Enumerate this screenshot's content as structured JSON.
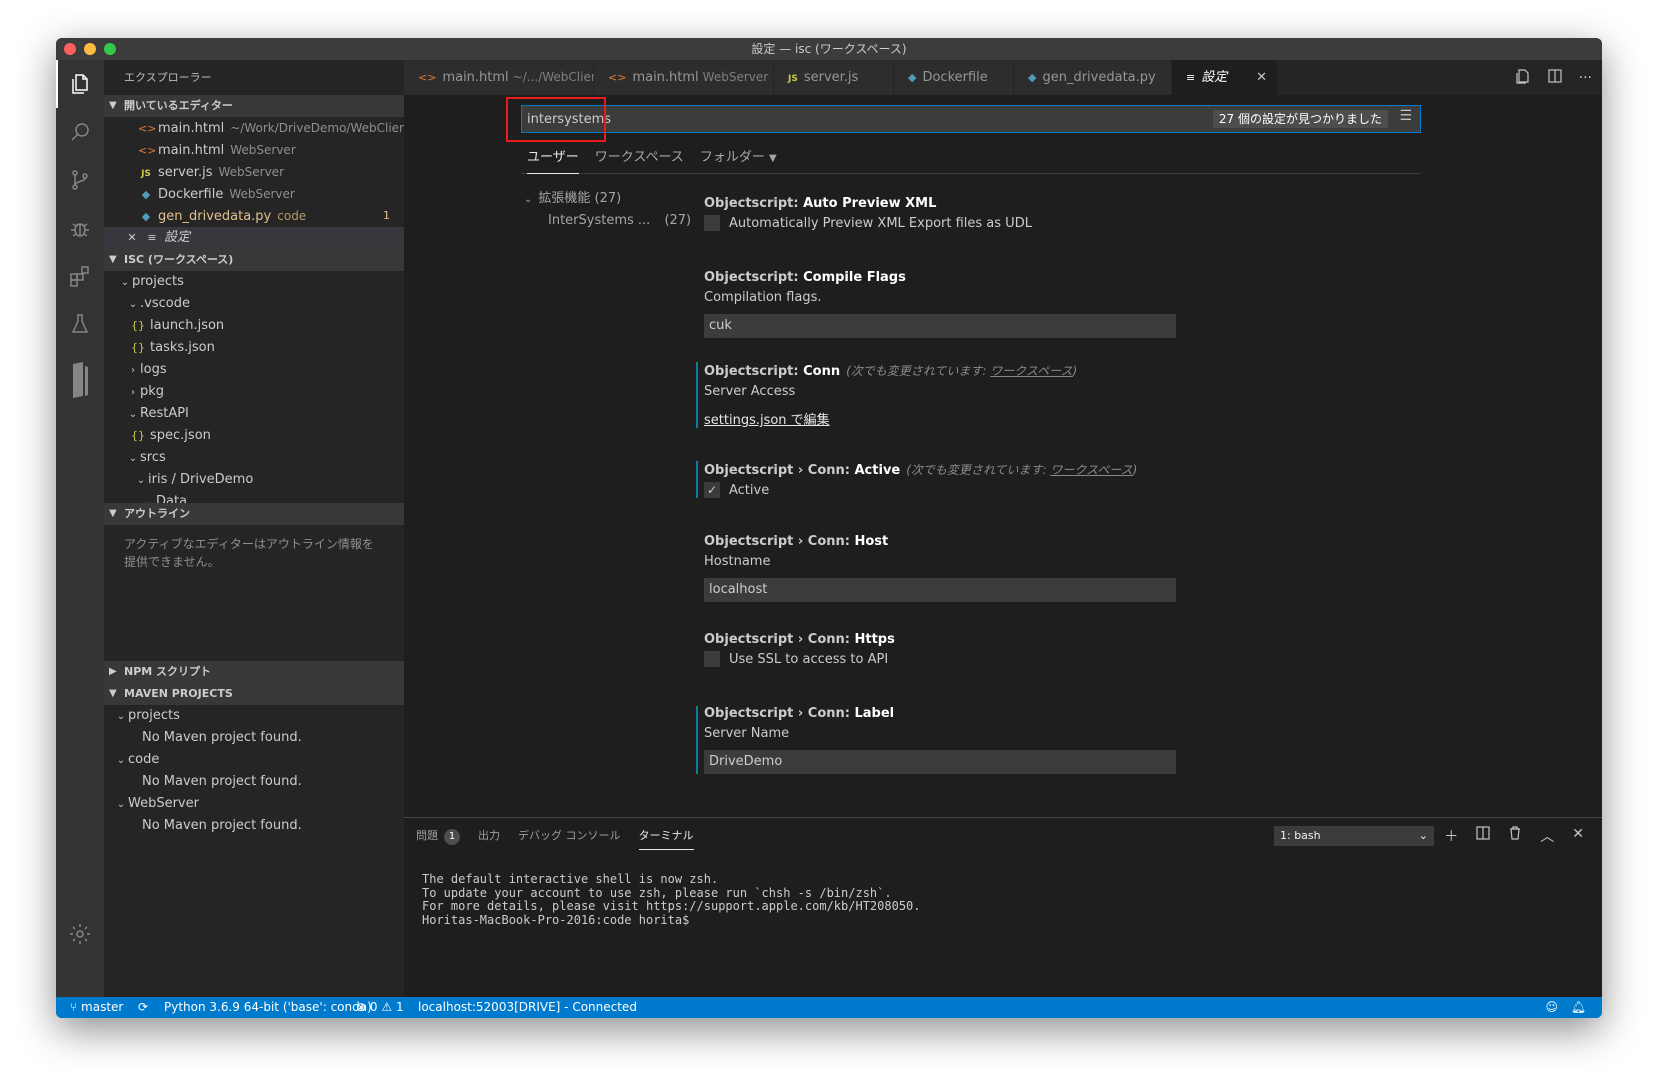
{
  "window": {
    "title": "設定 — isc (ワークスペース)"
  },
  "colors": {
    "accent": "#007acc",
    "highlight": "#e81c1c",
    "modified": "#0c7d9d",
    "modified_file": "#e2c08d"
  },
  "activity_bar": {
    "icons": [
      "files-icon",
      "search-icon",
      "source-control-icon",
      "debug-icon",
      "extensions-icon",
      "test-icon",
      "objectscript-icon",
      "gear-icon"
    ]
  },
  "sidebar": {
    "title": "エクスプローラー",
    "open_editors": {
      "header": "開いているエディター",
      "items": [
        {
          "label": "main.html",
          "desc": "~/Work/DriveDemo/WebClient",
          "icon": "html-icon"
        },
        {
          "label": "main.html",
          "desc": "WebServer",
          "icon": "html-icon"
        },
        {
          "label": "server.js",
          "desc": "WebServer",
          "icon": "js-icon"
        },
        {
          "label": "Dockerfile",
          "desc": "WebServer",
          "icon": "docker-icon"
        },
        {
          "label": "gen_drivedata.py",
          "desc": "code",
          "icon": "python-icon",
          "badge": "1"
        },
        {
          "label": "設定",
          "icon": "settings-file-icon"
        }
      ]
    },
    "workspace": {
      "header": "ISC (ワークスペース)",
      "items": [
        {
          "label": "projects"
        },
        {
          "label": ".vscode"
        },
        {
          "label": "launch.json"
        },
        {
          "label": "tasks.json"
        },
        {
          "label": "logs"
        },
        {
          "label": "pkg"
        },
        {
          "label": "RestAPI"
        },
        {
          "label": "spec.json"
        },
        {
          "label": "srcs"
        },
        {
          "label": "iris / DriveDemo"
        },
        {
          "label": "Data"
        }
      ]
    },
    "outline": {
      "header": "アウトライン",
      "message": "アクティブなエディターはアウトライン情報を提供できません。"
    },
    "npm": {
      "header": "NPM スクリプト"
    },
    "maven": {
      "header": "MAVEN PROJECTS",
      "items": [
        {
          "label": "projects",
          "message": "No Maven project found."
        },
        {
          "label": "code",
          "message": "No Maven project found."
        },
        {
          "label": "WebServer",
          "message": "No Maven project found."
        }
      ]
    }
  },
  "tabs": [
    {
      "label": "main.html",
      "desc": "~/.../WebClient",
      "icon": "html-icon"
    },
    {
      "label": "main.html",
      "desc": "WebServer",
      "icon": "html-icon"
    },
    {
      "label": "server.js",
      "desc": "",
      "icon": "js-icon"
    },
    {
      "label": "Dockerfile",
      "desc": "",
      "icon": "docker-icon"
    },
    {
      "label": "gen_drivedata.py",
      "desc": "",
      "icon": "python-icon"
    },
    {
      "label": "設定",
      "desc": "",
      "icon": "settings-file-icon",
      "active": true
    }
  ],
  "settings": {
    "search_value": "intersystems",
    "result_count": "27 個の設定が見つかりました",
    "scope_tabs": [
      "ユーザー",
      "ワークスペース",
      "フォルダー"
    ],
    "toc": [
      {
        "label": "拡張機能",
        "count": "(27)"
      },
      {
        "label": "InterSystems ...",
        "count": "(27)"
      }
    ],
    "items": [
      {
        "category": "Objectscript: ",
        "name": "Auto Preview XML",
        "type": "checkbox",
        "check_label": "Automatically Preview XML Export files as UDL",
        "checked": false
      },
      {
        "category": "Objectscript: ",
        "name": "Compile Flags",
        "type": "text",
        "desc": "Compilation flags.",
        "value": "cuk"
      },
      {
        "category": "Objectscript: ",
        "name": "Conn",
        "type": "link",
        "modified": true,
        "modified_text": "(次でも変更されています: ",
        "modified_scope": "ワークスペース",
        "modified_end": ")",
        "desc": "Server Access",
        "link": "settings.json で編集"
      },
      {
        "category": "Objectscript › Conn: ",
        "name": "Active",
        "type": "checkbox",
        "modified": true,
        "modified_text": "(次でも変更されています: ",
        "modified_scope": "ワークスペース",
        "modified_end": ")",
        "check_label": "Active",
        "checked": true
      },
      {
        "category": "Objectscript › Conn: ",
        "name": "Host",
        "type": "text",
        "desc": "Hostname",
        "value": "localhost"
      },
      {
        "category": "Objectscript › Conn: ",
        "name": "Https",
        "type": "checkbox",
        "check_label": "Use SSL to access to API",
        "checked": false
      },
      {
        "category": "Objectscript › Conn: ",
        "name": "Label",
        "type": "text",
        "modified": true,
        "desc": "Server Name",
        "value": "DriveDemo"
      }
    ]
  },
  "panel": {
    "tabs": [
      {
        "label": "問題",
        "badge": "1"
      },
      {
        "label": "出力"
      },
      {
        "label": "デバッグ コンソール"
      },
      {
        "label": "ターミナル",
        "active": true
      }
    ],
    "terminal_select": "1: bash",
    "terminal_lines": [
      "The default interactive shell is now zsh.",
      "To update your account to use zsh, please run `chsh -s /bin/zsh`.",
      "For more details, please visit https://support.apple.com/kb/HT208050.",
      "Horitas-MacBook-Pro-2016:code horita$"
    ]
  },
  "statusbar": {
    "branch": "master",
    "python": "Python 3.6.9 64-bit ('base': conda)",
    "errors": "0",
    "warnings": "1",
    "connection": "localhost:52003[DRIVE] - Connected"
  }
}
